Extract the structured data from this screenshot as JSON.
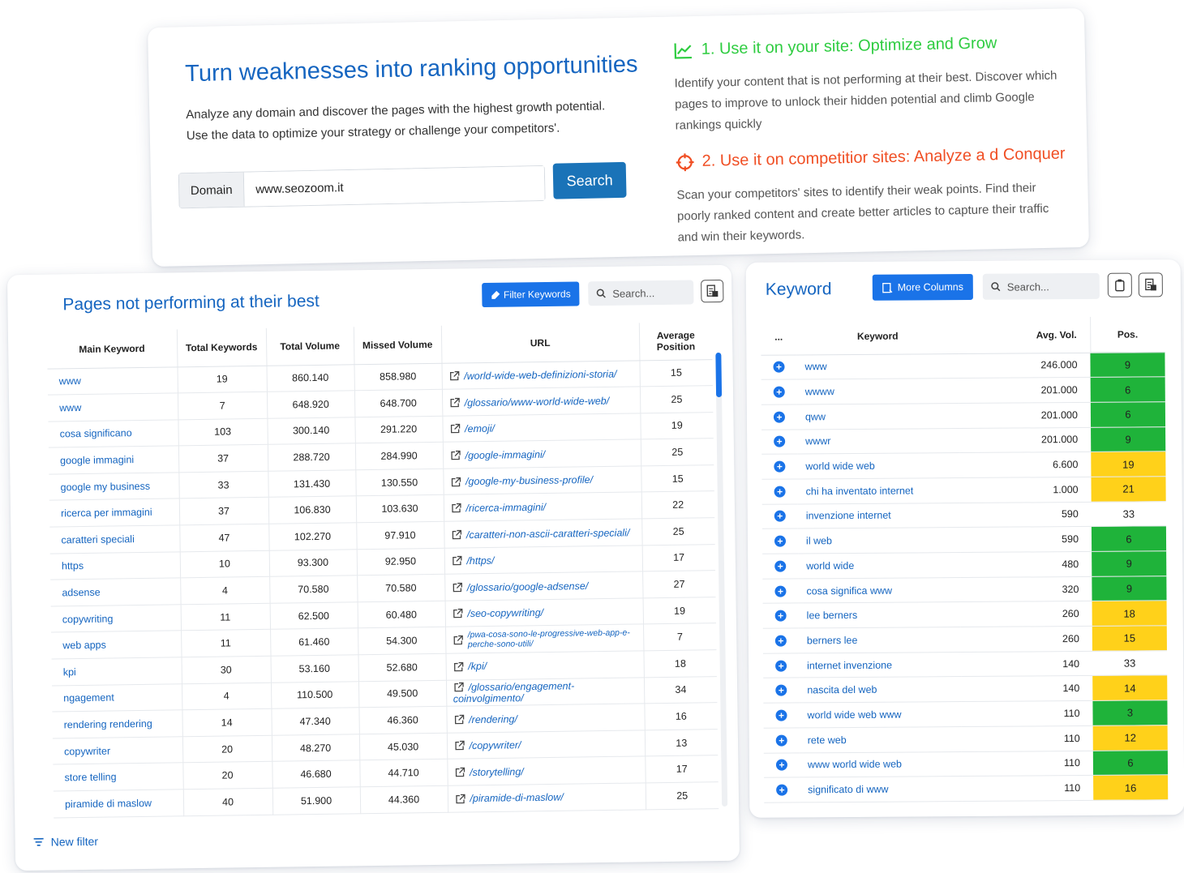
{
  "hero": {
    "headline": "Turn weaknesses into ranking opportunities",
    "sub1": "Analyze any domain and discover the pages with the highest growth potential.",
    "sub2": "Use the data to optimize your strategy or challenge your competitors'.",
    "domain_label": "Domain",
    "domain_value": "www.seozoom.it",
    "search_label": "Search",
    "use1_title": "1. Use it on your site: Optimize and Grow",
    "use1_text": "Identify your content that is not performing at their best. Discover which pages to improve to unlock their hidden potential and climb Google rankings quickly",
    "use2_title": "2. Use it on competitior sites: Analyze a d Conquer",
    "use2_text": "Scan your competitors' sites to identify their weak points. Find their poorly ranked content and create better articles to capture their traffic and win their keywords.",
    "colors": {
      "title_blue": "#1565c0",
      "green": "#2ecc40",
      "orange": "#f04e23",
      "button": "#1a73b8"
    }
  },
  "pages_table": {
    "title": "Pages not performing at their best",
    "filter_label": "Filter Keywords",
    "search_placeholder": "Search...",
    "new_filter_label": "New filter",
    "headers": [
      "Main Keyword",
      "Total Keywords",
      "Total Volume",
      "Missed Volume",
      "URL",
      "Average Position"
    ],
    "rows": [
      [
        "www",
        "19",
        "860.140",
        "858.980",
        "/world-wide-web-definizioni-storia/",
        "15"
      ],
      [
        "www",
        "7",
        "648.920",
        "648.700",
        "/glossario/www-world-wide-web/",
        "25"
      ],
      [
        "cosa significano",
        "103",
        "300.140",
        "291.220",
        "/emoji/",
        "19"
      ],
      [
        "google immagini",
        "37",
        "288.720",
        "284.990",
        "/google-immagini/",
        "25"
      ],
      [
        "google my business",
        "33",
        "131.430",
        "130.550",
        "/google-my-business-profile/",
        "15"
      ],
      [
        "ricerca per immagini",
        "37",
        "106.830",
        "103.630",
        "/ricerca-immagini/",
        "22"
      ],
      [
        "caratteri speciali",
        "47",
        "102.270",
        "97.910",
        "/caratteri-non-ascii-caratteri-speciali/",
        "25"
      ],
      [
        "https",
        "10",
        "93.300",
        "92.950",
        "/https/",
        "17"
      ],
      [
        "adsense",
        "4",
        "70.580",
        "70.580",
        "/glossario/google-adsense/",
        "27"
      ],
      [
        "copywriting",
        "11",
        "62.500",
        "60.480",
        "/seo-copywriting/",
        "19"
      ],
      [
        "web apps",
        "11",
        "61.460",
        "54.300",
        "/pwa-cosa-sono-le-progressive-web-app-e-perche-sono-utili/",
        "7"
      ],
      [
        "kpi",
        "30",
        "53.160",
        "52.680",
        "/kpi/",
        "18"
      ],
      [
        "ngagement",
        "4",
        "110.500",
        "49.500",
        "/glossario/engagement-coinvolgimento/",
        "34"
      ],
      [
        "rendering rendering",
        "14",
        "47.340",
        "46.360",
        "/rendering/",
        "16"
      ],
      [
        "copywriter",
        "20",
        "48.270",
        "45.030",
        "/copywriter/",
        "13"
      ],
      [
        "store telling",
        "20",
        "46.680",
        "44.710",
        "/storytelling/",
        "17"
      ],
      [
        "piramide di maslow",
        "40",
        "51.900",
        "44.360",
        "/piramide-di-maslow/",
        "25"
      ]
    ]
  },
  "keyword_table": {
    "title": "Keyword",
    "more_columns_label": "More Columns",
    "search_placeholder": "Search...",
    "headers": [
      "...",
      "Keyword",
      "Avg. Vol.",
      "Pos."
    ],
    "rows": [
      {
        "kw": "www",
        "vol": "246.000",
        "pos": "9",
        "level": "green"
      },
      {
        "kw": "wwww",
        "vol": "201.000",
        "pos": "6",
        "level": "green"
      },
      {
        "kw": "qww",
        "vol": "201.000",
        "pos": "6",
        "level": "green"
      },
      {
        "kw": "wwwr",
        "vol": "201.000",
        "pos": "9",
        "level": "green"
      },
      {
        "kw": "world wide web",
        "vol": "6.600",
        "pos": "19",
        "level": "yellow"
      },
      {
        "kw": "chi ha inventato internet",
        "vol": "1.000",
        "pos": "21",
        "level": "yellow"
      },
      {
        "kw": "invenzione internet",
        "vol": "590",
        "pos": "33",
        "level": "none"
      },
      {
        "kw": "il web",
        "vol": "590",
        "pos": "6",
        "level": "green"
      },
      {
        "kw": "world wide",
        "vol": "480",
        "pos": "9",
        "level": "green"
      },
      {
        "kw": "cosa significa www",
        "vol": "320",
        "pos": "9",
        "level": "green"
      },
      {
        "kw": "lee berners",
        "vol": "260",
        "pos": "18",
        "level": "yellow"
      },
      {
        "kw": "berners lee",
        "vol": "260",
        "pos": "15",
        "level": "yellow"
      },
      {
        "kw": "internet invenzione",
        "vol": "140",
        "pos": "33",
        "level": "none"
      },
      {
        "kw": "nascita del web",
        "vol": "140",
        "pos": "14",
        "level": "yellow"
      },
      {
        "kw": "world wide web www",
        "vol": "110",
        "pos": "3",
        "level": "green"
      },
      {
        "kw": "rete web",
        "vol": "110",
        "pos": "12",
        "level": "yellow"
      },
      {
        "kw": "www world wide web",
        "vol": "110",
        "pos": "6",
        "level": "green"
      },
      {
        "kw": "significato di www",
        "vol": "110",
        "pos": "16",
        "level": "yellow"
      }
    ]
  }
}
